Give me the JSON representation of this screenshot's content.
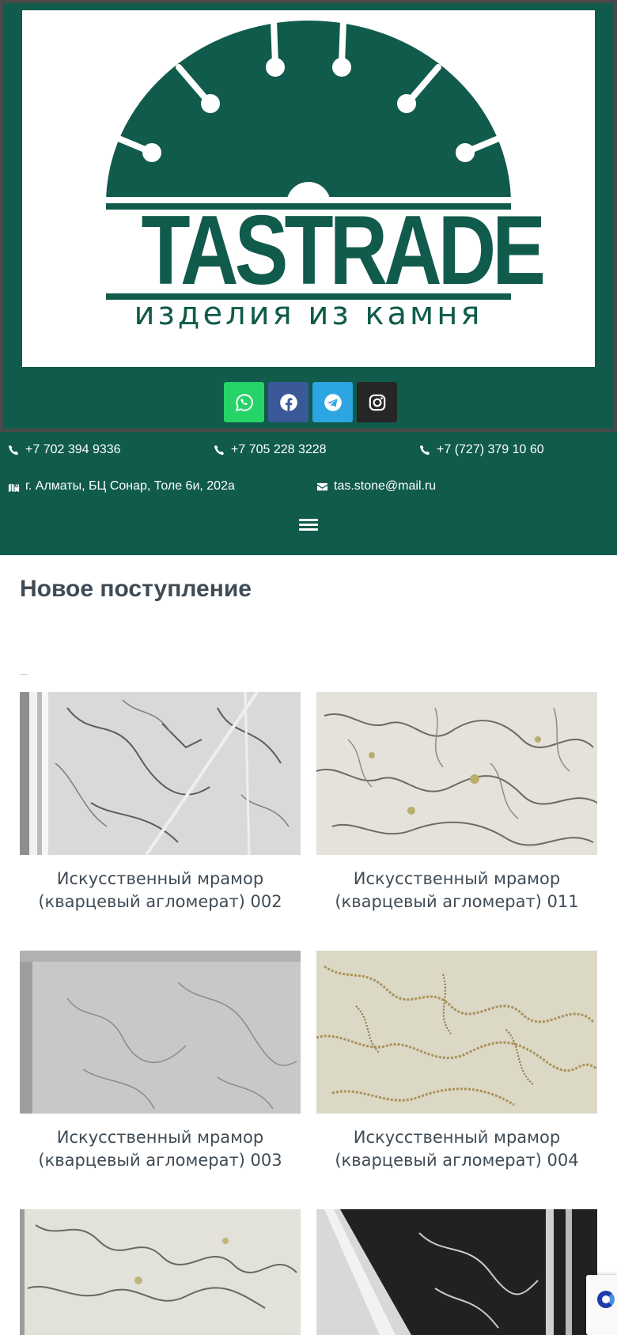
{
  "brand": {
    "name": "TASTRADE",
    "tagline": "изделия из камня",
    "color": "#105b4b"
  },
  "socials": [
    {
      "name": "whatsapp",
      "icon": "whatsapp-icon",
      "color": "#25d366"
    },
    {
      "name": "facebook",
      "icon": "facebook-icon",
      "color": "#3b5998"
    },
    {
      "name": "telegram",
      "icon": "telegram-icon",
      "color": "#2ca5e0"
    },
    {
      "name": "instagram",
      "icon": "instagram-icon",
      "color": "#262626"
    }
  ],
  "contacts": {
    "phone1": "+7 702 394 9336",
    "phone2": "+7 705 228 3228",
    "phone3": "+7 (727) 379 10 60",
    "address": "г. Алматы, БЦ Сонар, Толе 6и, 202а",
    "email": "tas.stone@mail.ru"
  },
  "section": {
    "title": "Новое поступление"
  },
  "products": [
    {
      "line1": "Искусственный мрамор",
      "line2": "(кварцевый агломерат) 002"
    },
    {
      "line1": "Искусственный мрамор",
      "line2": "(кварцевый агломерат) 011"
    },
    {
      "line1": "Искусственный мрамор",
      "line2": "(кварцевый агломерат) 003"
    },
    {
      "line1": "Искусственный мрамор",
      "line2": "(кварцевый агломерат) 004"
    }
  ]
}
